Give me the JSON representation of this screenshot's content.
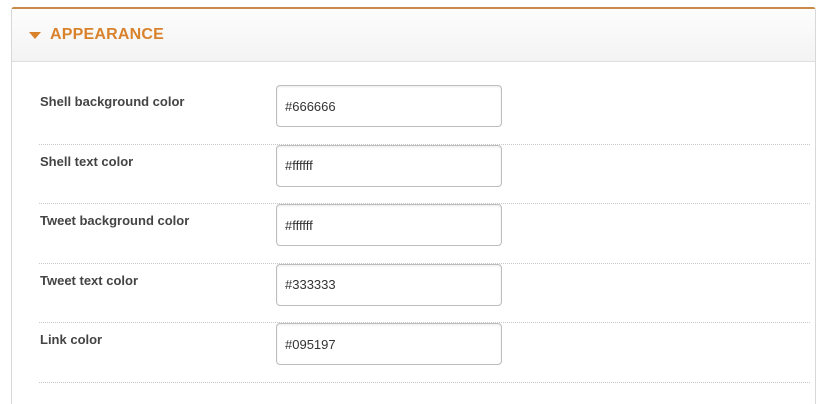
{
  "section": {
    "title": "APPEARANCE",
    "toggle_icon": "triangle-down-icon",
    "accent_color": "#d9822b"
  },
  "fields": [
    {
      "label": "Shell background color",
      "value": "#666666"
    },
    {
      "label": "Shell text color",
      "value": "#ffffff"
    },
    {
      "label": "Tweet background color",
      "value": "#ffffff"
    },
    {
      "label": "Tweet text color",
      "value": "#333333"
    },
    {
      "label": "Link color",
      "value": "#095197"
    }
  ]
}
